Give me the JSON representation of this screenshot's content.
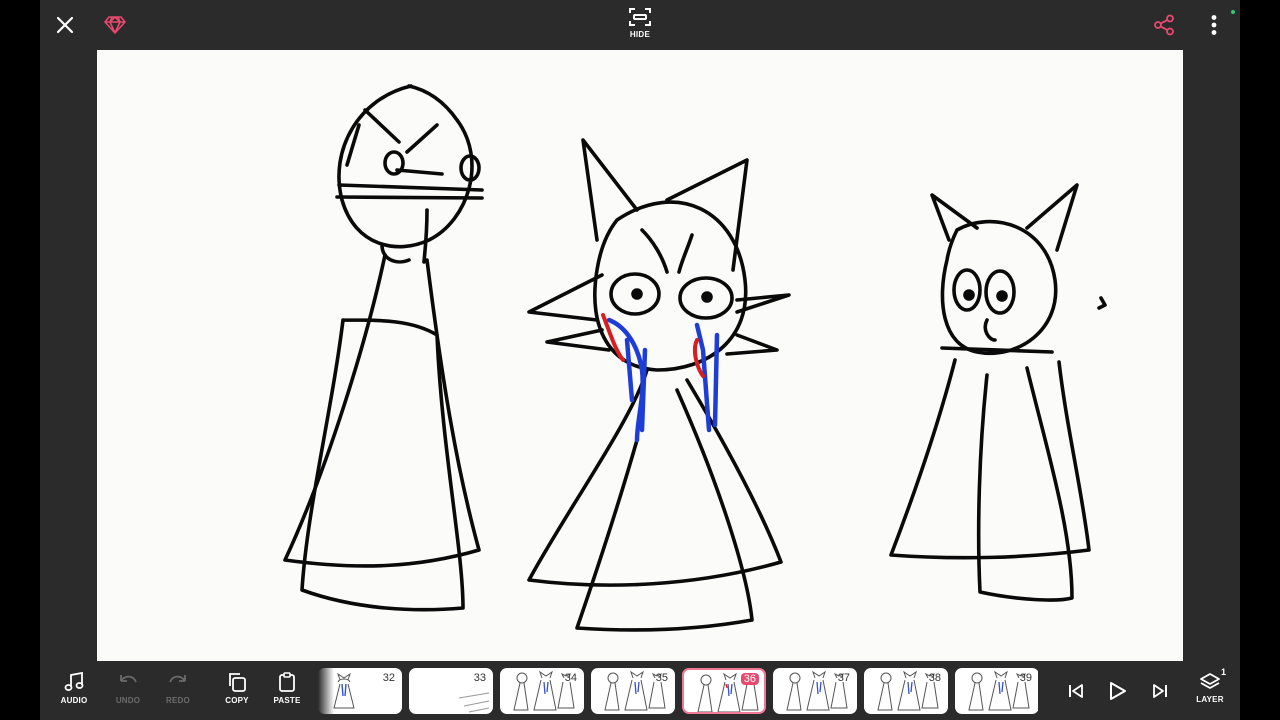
{
  "header": {
    "close_icon": "close-icon",
    "premium_icon": "diamond-icon",
    "hide_label": "HIDE",
    "share_icon": "share-icon",
    "more_icon": "more-vertical-icon",
    "colors": {
      "accent": "#e8496e",
      "status": "#2ecc71"
    }
  },
  "toolbar": {
    "audio_label": "AUDIO",
    "undo_label": "UNDO",
    "redo_label": "REDO",
    "copy_label": "COPY",
    "paste_label": "PASTE",
    "layer_label": "LAYER",
    "layer_count": "1"
  },
  "timeline": {
    "frames": [
      {
        "number": "32",
        "content": "figures"
      },
      {
        "number": "33",
        "content": "lines"
      },
      {
        "number": "34",
        "content": "figures"
      },
      {
        "number": "35",
        "content": "figures"
      },
      {
        "number": "36",
        "content": "figures",
        "selected": true
      },
      {
        "number": "37",
        "content": "figures"
      },
      {
        "number": "38",
        "content": "figures"
      },
      {
        "number": "39",
        "content": "figures"
      }
    ]
  },
  "playback": {
    "prev_icon": "skip-previous-icon",
    "play_icon": "play-icon",
    "next_icon": "skip-next-icon"
  }
}
